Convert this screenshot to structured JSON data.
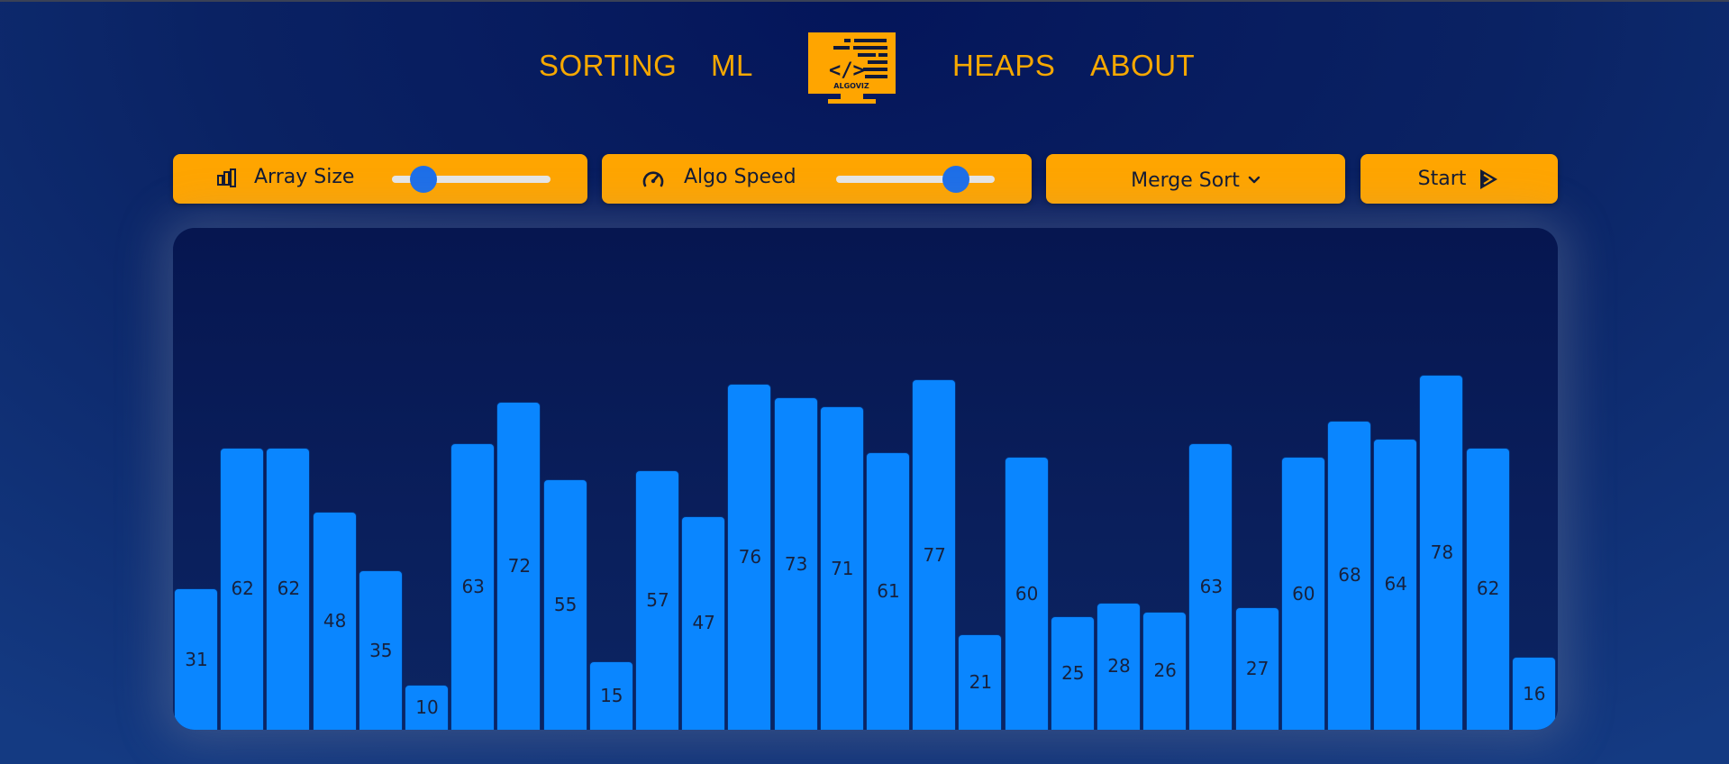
{
  "nav": {
    "sorting": "SORTING",
    "ml": "ML",
    "logo_text": "ALGOVIZ",
    "heaps": "HEAPS",
    "about": "ABOUT"
  },
  "controls": {
    "array_size": {
      "label": "Array Size",
      "icon": "bars-icon",
      "value_fraction": 0.2
    },
    "algo_speed": {
      "label": "Algo Speed",
      "icon": "speedometer-icon",
      "value_fraction": 0.76
    },
    "algorithm": {
      "selected": "Merge Sort",
      "icon": "chevron-down-icon"
    },
    "start": {
      "label": "Start",
      "icon": "play-icon"
    }
  },
  "colors": {
    "accent": "#ffa500",
    "bar": "#0a86ff",
    "slider_thumb": "#1e6fe8",
    "nav_text": "#f6a800"
  },
  "chart_data": {
    "type": "bar",
    "values": [
      31,
      62,
      62,
      48,
      35,
      10,
      63,
      72,
      55,
      15,
      57,
      47,
      76,
      73,
      71,
      61,
      77,
      21,
      60,
      25,
      28,
      26,
      63,
      27,
      60,
      68,
      64,
      78,
      62,
      16
    ]
  }
}
